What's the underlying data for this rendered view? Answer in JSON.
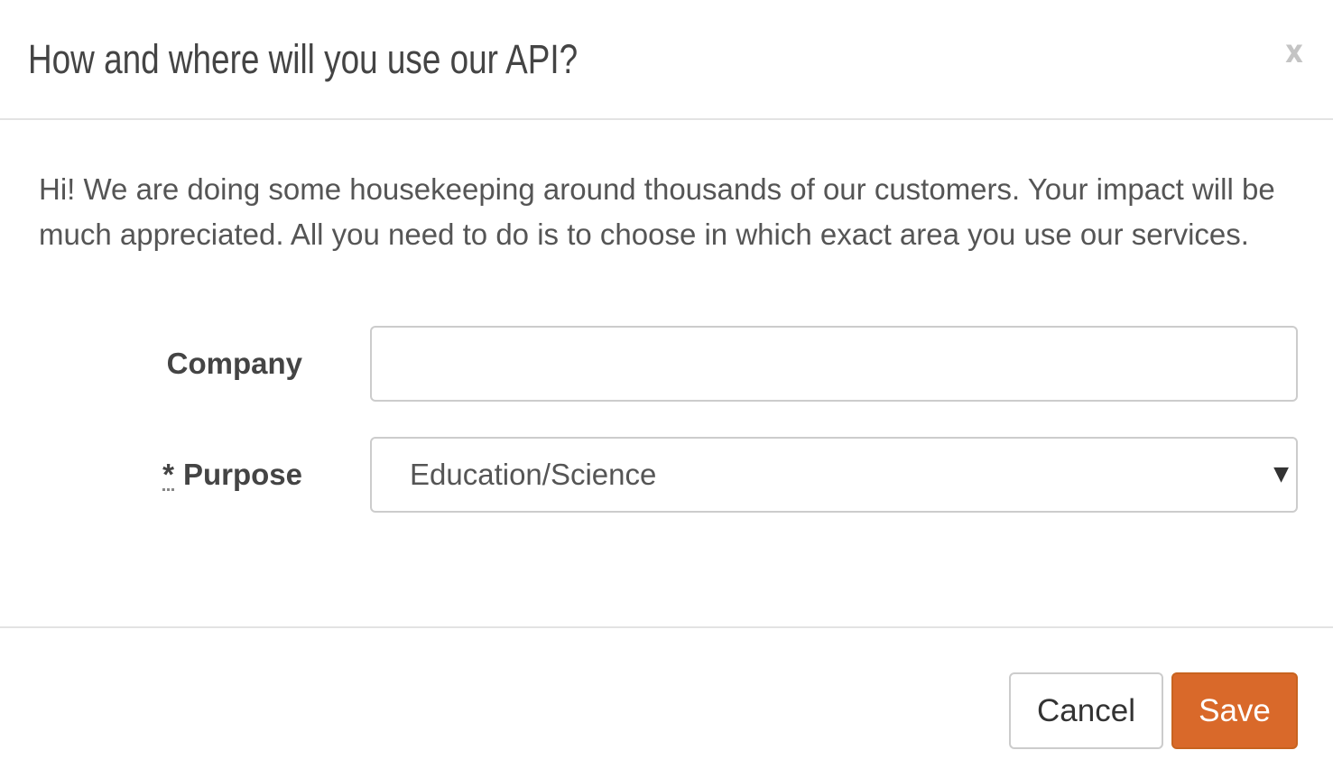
{
  "dialog": {
    "title": "How and where will you use our API?",
    "close_label": "x"
  },
  "body": {
    "intro_text": "Hi! We are doing some housekeeping around thousands of our customers. Your impact will be much appreciated. All you need to do is to choose in which exact area you use our services."
  },
  "form": {
    "company": {
      "label": "Company",
      "value": "",
      "placeholder": ""
    },
    "purpose": {
      "required_marker": "*",
      "label": "Purpose",
      "selected_value": "Education/Science",
      "arrow": "▼"
    }
  },
  "footer": {
    "cancel_label": "Cancel",
    "save_label": "Save"
  },
  "colors": {
    "accent": "#d9692a",
    "border": "#cccccc",
    "divider": "#e3e3e3",
    "text": "#444444"
  }
}
